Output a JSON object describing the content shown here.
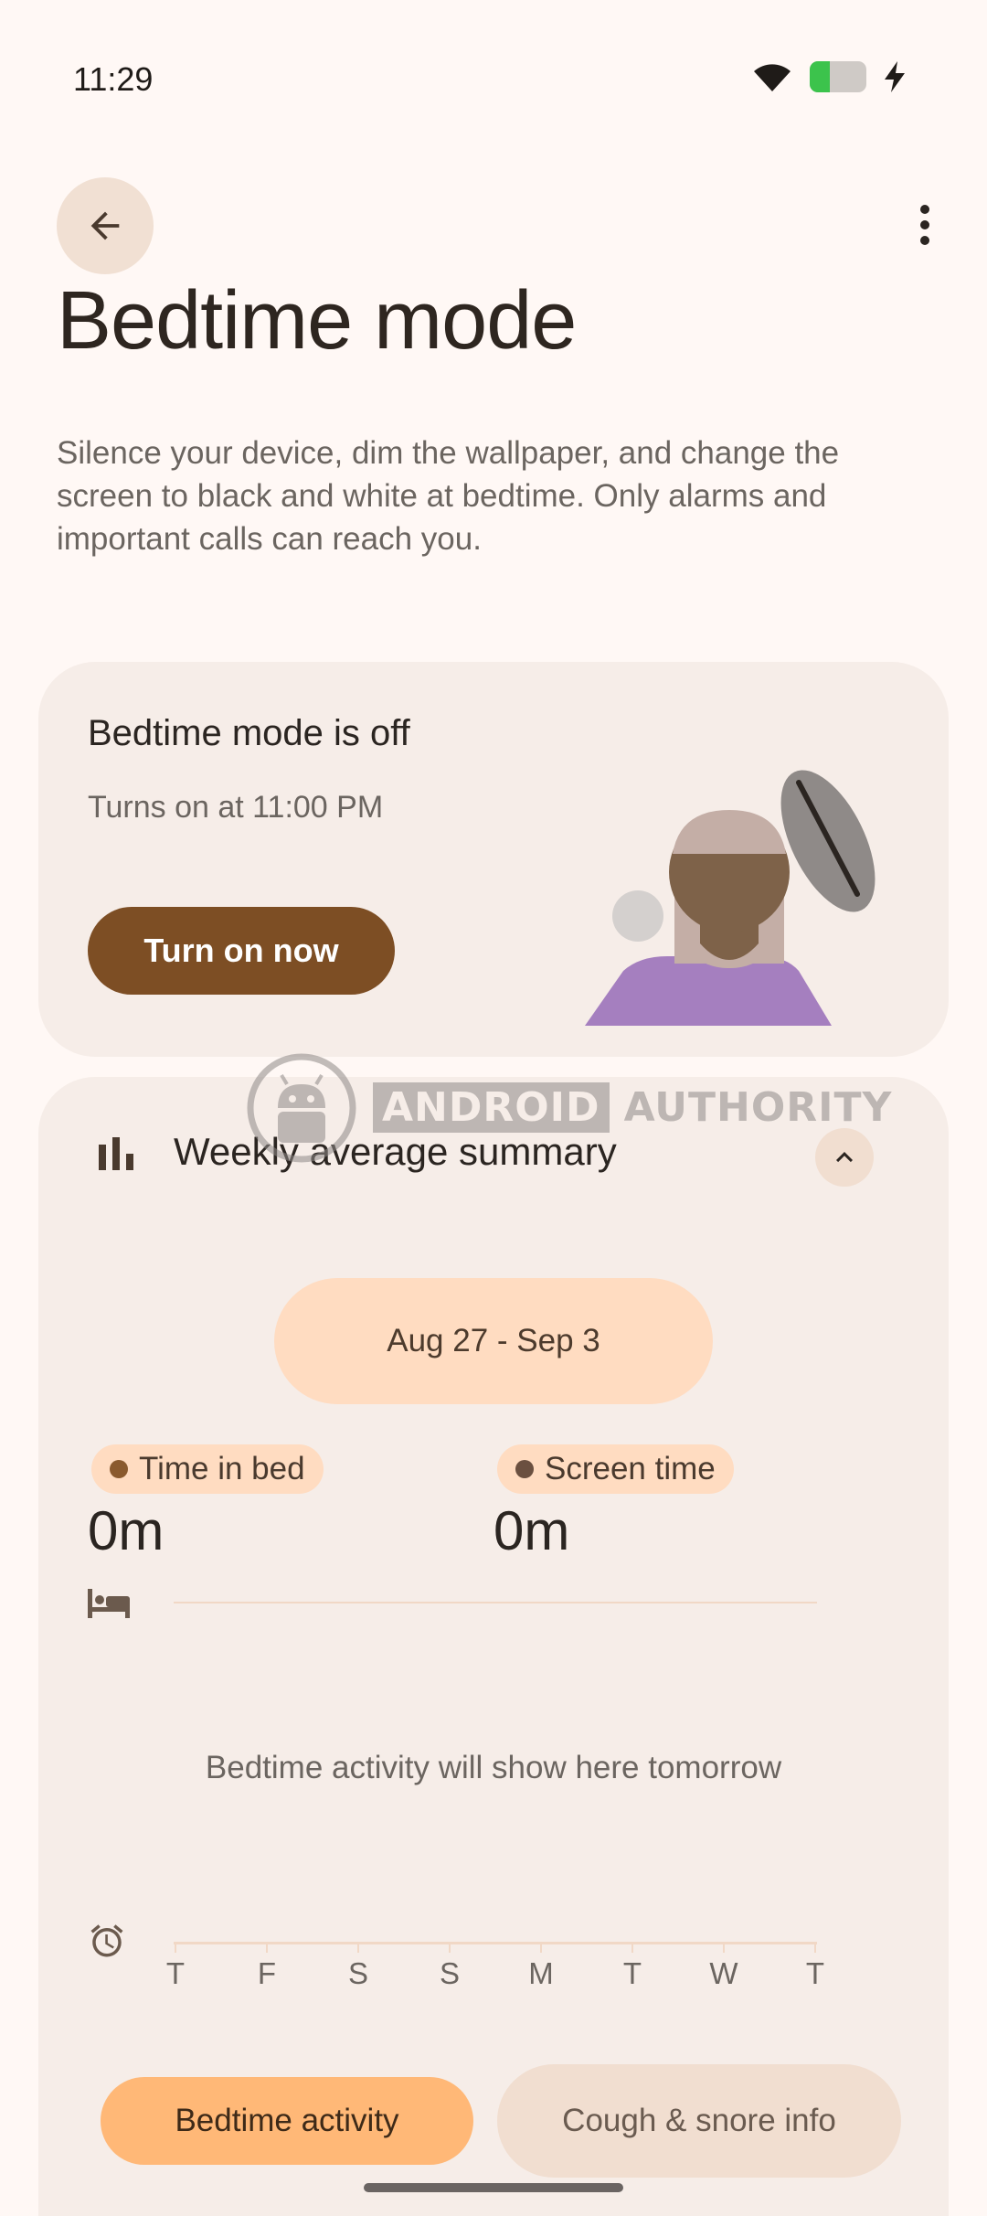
{
  "status_bar": {
    "time": "11:29",
    "wifi_icon": "wifi-icon",
    "battery_level_fraction": 0.35,
    "charging": true
  },
  "header": {
    "back_icon": "arrow-back-icon",
    "more_icon": "more-vert-icon",
    "title": "Bedtime mode",
    "description": "Silence your device, dim the wallpaper, and change the screen to black and white at bedtime. Only alarms and important calls can reach you."
  },
  "status_card": {
    "state": "Bedtime mode is off",
    "schedule": "Turns on at 11:00 PM",
    "button": "Turn on now",
    "illustration": "person-sleeping-illustration"
  },
  "summary": {
    "icon": "bar-chart-icon",
    "title": "Weekly average summary",
    "collapse_icon": "chevron-up-icon",
    "date_range": "Aug 27 - Sep 3",
    "metrics": [
      {
        "label": "Time in bed",
        "value": "0m",
        "dot_color": "#8A5A2E"
      },
      {
        "label": "Screen time",
        "value": "0m",
        "dot_color": "#6B5040"
      }
    ],
    "bed_icon": "bed-icon",
    "alarm_icon": "alarm-icon",
    "empty_message": "Bedtime activity will show here tomorrow",
    "days": [
      "T",
      "F",
      "S",
      "S",
      "M",
      "T",
      "W",
      "T"
    ],
    "tabs": [
      {
        "label": "Bedtime activity",
        "selected": true
      },
      {
        "label": "Cough & snore info",
        "selected": false
      }
    ]
  },
  "watermark": {
    "part1": "ANDROID",
    "part2": "AUTHORITY"
  },
  "colors": {
    "background": "#FFF8F5",
    "card": "#F6EDE8",
    "primary_button": "#7D4E24",
    "chip": "#FFDCC1",
    "selected_tab": "#FFB877"
  }
}
